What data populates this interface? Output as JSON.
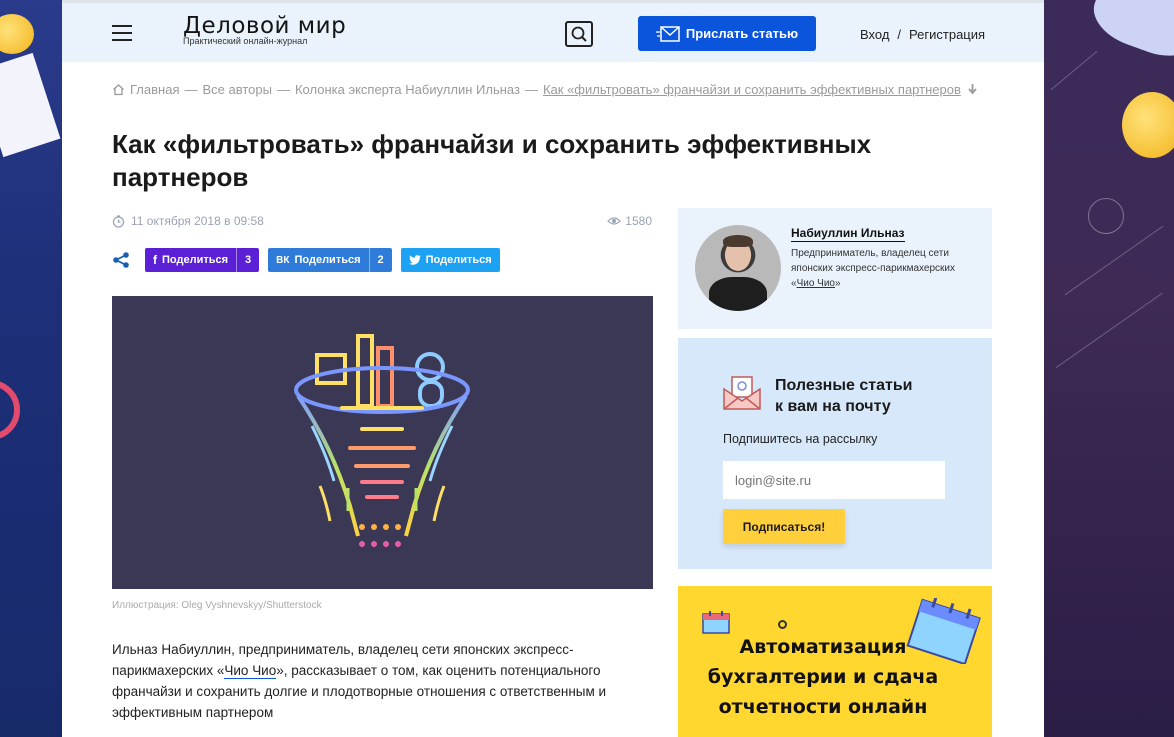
{
  "header": {
    "logo_title": "Деловой мир",
    "logo_subtitle": "Практический онлайн-журнал",
    "send_article_label": "Прислать статью",
    "login_label": "Вход",
    "auth_separator": "/",
    "register_label": "Регистрация"
  },
  "breadcrumbs": {
    "items": [
      "Главная",
      "—",
      "Все авторы",
      "—",
      "Колонка эксперта Набиуллин Ильназ",
      "—"
    ],
    "current": "Как «фильтровать» франчайзи и сохранить эффективных партнеров"
  },
  "article": {
    "title": "Как «фильтровать» франчайзи и сохранить эффективных партнеров",
    "date": "11 октября 2018 в 09:58",
    "views": "1580",
    "share": {
      "facebook_label": "Поделиться",
      "facebook_count": "3",
      "vk_label": "Поделиться",
      "vk_count": "2",
      "twitter_label": "Поделиться"
    },
    "caption": "Иллюстрация: Oleg Vyshnevskyy/Shutterstock",
    "lead_before": "Ильназ Набиуллин, предприниматель, владелец сети японских экспресс-парикмахерских «",
    "lead_link": "Чио Чио",
    "lead_after": "», рассказывает о том, как оценить потенциального франчайзи и сохранить долгие и плодотворные отношения с ответственным и эффективным партнером"
  },
  "author": {
    "name": "Набиуллин Ильназ",
    "desc_before": "Предприниматель, владелец сети японских экспресс-парикмахерских «",
    "desc_link": "Чио Чио",
    "desc_after": "»"
  },
  "newsletter": {
    "title_line1": "Полезные статьи",
    "title_line2": "к вам на почту",
    "subtitle": "Подпишитесь на рассылку",
    "input_placeholder": "login@site.ru",
    "button_label": "Подписаться!"
  },
  "promo": {
    "line1": "Автоматизация",
    "line2": "бухгалтерии и сдача",
    "line3": "отчетности онлайн"
  },
  "colors": {
    "brand_blue": "#0b55dc",
    "facebook": "#5b20d6",
    "vk": "#2e7bd9",
    "twitter": "#1da1f2",
    "subscribe_yellow": "#ffcf3c",
    "promo_yellow": "#ffd72e"
  },
  "icons": [
    "menu-icon",
    "search-icon",
    "mail-send-icon",
    "home-icon",
    "arrow-down-icon",
    "clock-icon",
    "eye-icon",
    "share-icon",
    "facebook-icon",
    "vk-icon",
    "twitter-icon",
    "envelope-icon",
    "calendar-icon"
  ]
}
